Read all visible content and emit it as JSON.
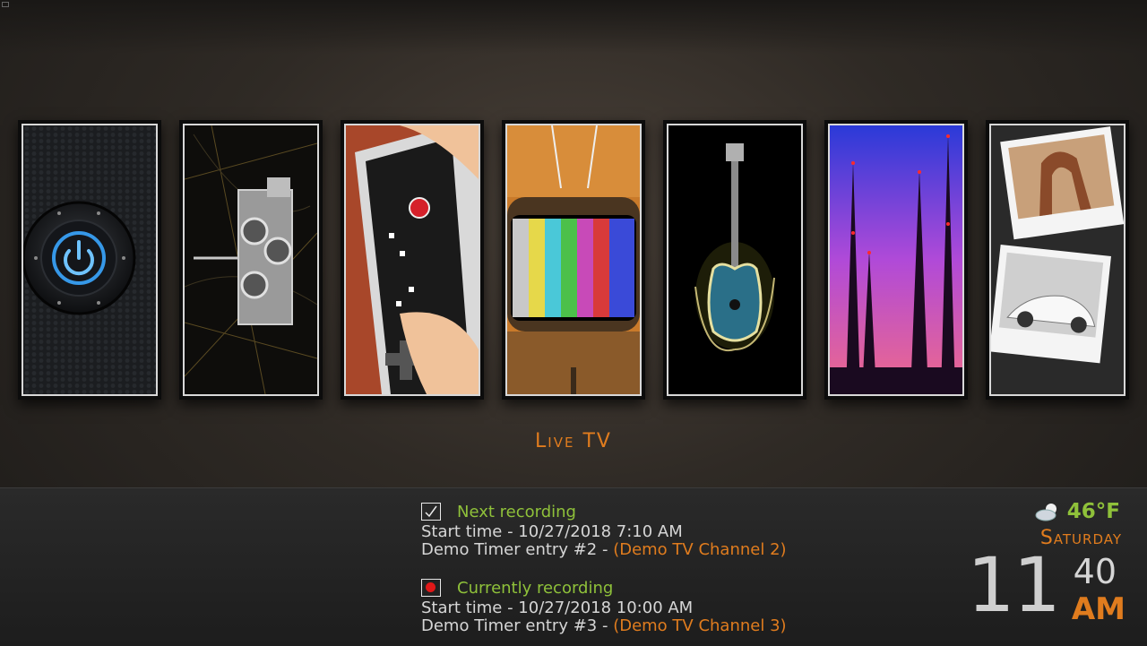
{
  "menu": {
    "items": [
      {
        "id": "power",
        "icon": "power-icon"
      },
      {
        "id": "videos",
        "icon": "movie-camera-icon"
      },
      {
        "id": "games",
        "icon": "gamepad-icon"
      },
      {
        "id": "live-tv",
        "icon": "tv-icon"
      },
      {
        "id": "music",
        "icon": "guitar-icon"
      },
      {
        "id": "radio",
        "icon": "radio-tower-icon"
      },
      {
        "id": "pictures",
        "icon": "photos-icon"
      }
    ],
    "focused_label": "Live TV"
  },
  "recordings": {
    "next": {
      "title": "Next recording",
      "start": "Start time - 10/27/2018 7:10 AM",
      "entry": "Demo Timer entry #2",
      "separator": " - ",
      "channel": "(Demo TV Channel 2)"
    },
    "current": {
      "title": "Currently recording",
      "start": "Start time - 10/27/2018 10:00 AM",
      "entry": "Demo Timer entry #3",
      "separator": " - ",
      "channel": "(Demo TV Channel 3)"
    }
  },
  "weather": {
    "temp": "46°F",
    "icon": "partly-cloudy-icon"
  },
  "clock": {
    "day": "Saturday",
    "hour": "11",
    "minute": "40",
    "ampm": "AM"
  },
  "colors": {
    "accent": "#e07c1e",
    "green": "#8fc13a"
  }
}
